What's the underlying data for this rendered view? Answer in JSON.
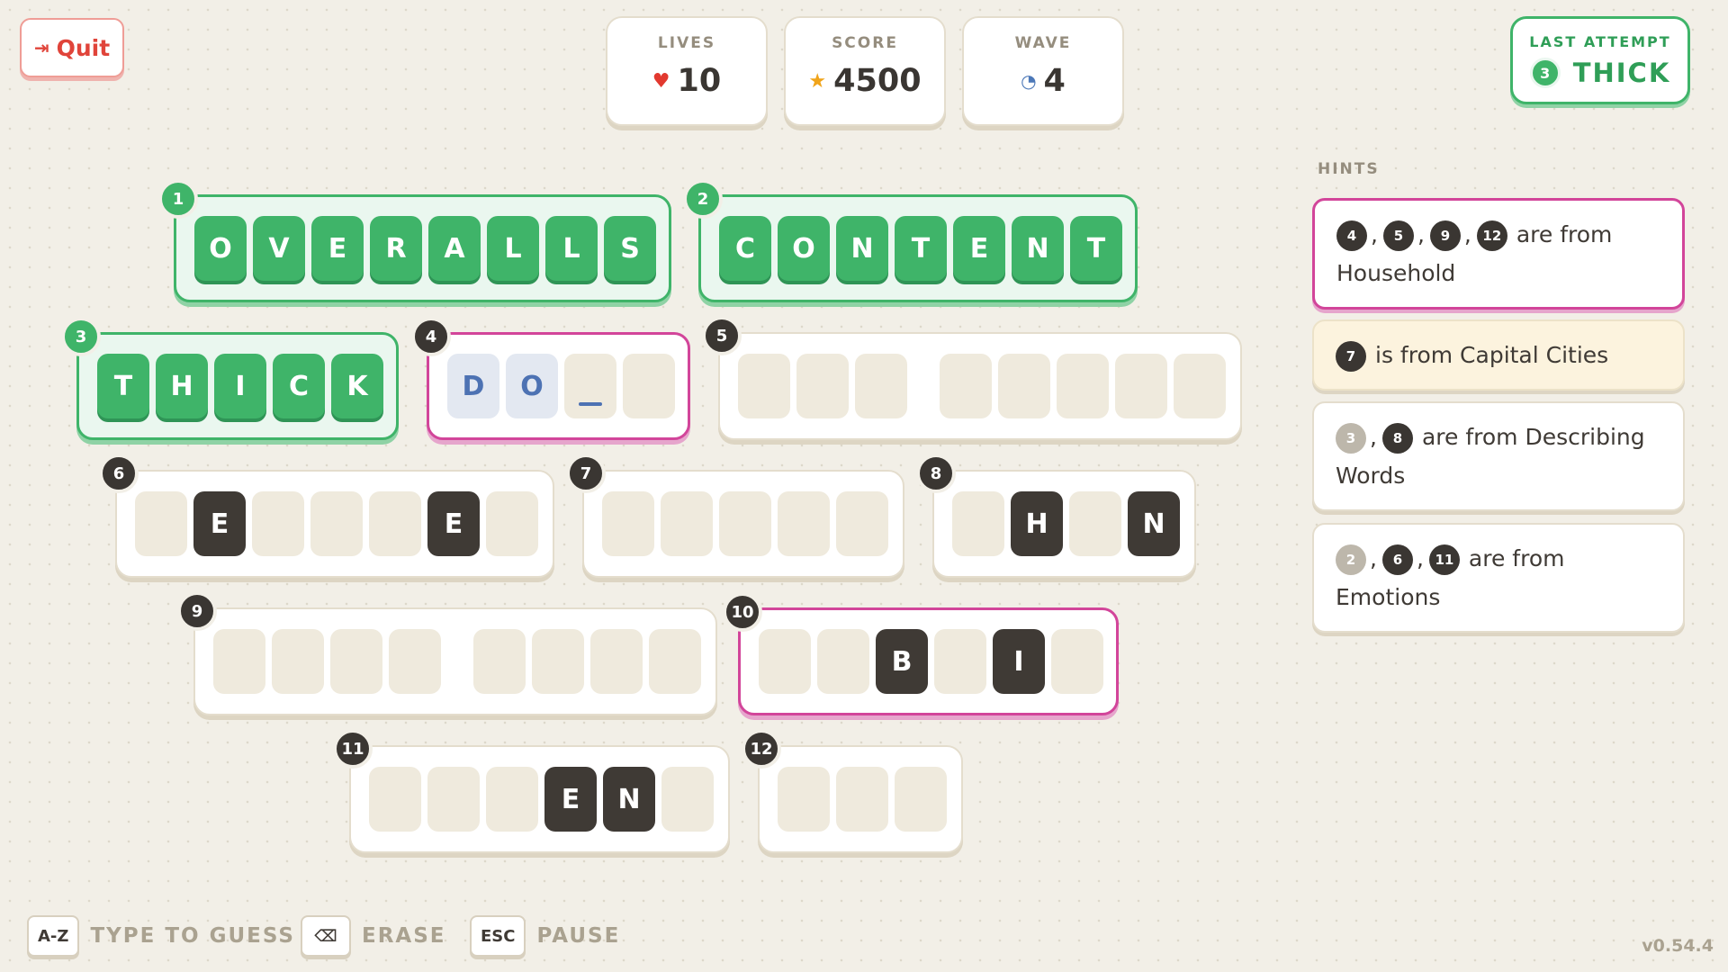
{
  "header": {
    "quit_label": "Quit",
    "lives_label": "LIVES",
    "lives_value": "10",
    "score_label": "SCORE",
    "score_value": "4500",
    "wave_label": "WAVE",
    "wave_value": "4"
  },
  "last_attempt": {
    "label": "LAST ATTEMPT",
    "number": "3",
    "word": "THICK"
  },
  "hints": {
    "title": "HINTS",
    "items": [
      {
        "numbers": [
          "4",
          "5",
          "9",
          "12"
        ],
        "done": [
          false,
          false,
          false,
          false
        ],
        "text": "are from Household",
        "highlight": "pink"
      },
      {
        "numbers": [
          "7"
        ],
        "done": [
          false
        ],
        "text": "is from Capital Cities",
        "highlight": "yellow"
      },
      {
        "numbers": [
          "3",
          "8"
        ],
        "done": [
          true,
          false
        ],
        "text": "are from Describing Words",
        "highlight": "none"
      },
      {
        "numbers": [
          "2",
          "6",
          "11"
        ],
        "done": [
          true,
          false,
          false
        ],
        "text": "are from Emotions",
        "highlight": "none"
      }
    ]
  },
  "words": [
    {
      "num": "1",
      "state": "solved",
      "tiles": [
        "O",
        "V",
        "E",
        "R",
        "A",
        "L",
        "L",
        "S"
      ]
    },
    {
      "num": "2",
      "state": "solved",
      "tiles": [
        "C",
        "O",
        "N",
        "T",
        "E",
        "N",
        "T"
      ]
    },
    {
      "num": "3",
      "state": "solved",
      "tiles": [
        "T",
        "H",
        "I",
        "C",
        "K"
      ]
    },
    {
      "num": "4",
      "state": "active",
      "tiles": [
        "D",
        "O",
        "",
        ""
      ],
      "typed": [
        true,
        true,
        false,
        false
      ],
      "cursor": 2
    },
    {
      "num": "5",
      "state": "empty",
      "tiles": [
        "",
        "",
        "",
        "|",
        "",
        "",
        "",
        "",
        ""
      ]
    },
    {
      "num": "6",
      "state": "empty",
      "tiles": [
        "",
        "E",
        "",
        "",
        "",
        "E",
        ""
      ]
    },
    {
      "num": "7",
      "state": "empty",
      "tiles": [
        "",
        "",
        "",
        "",
        ""
      ]
    },
    {
      "num": "8",
      "state": "empty",
      "tiles": [
        "",
        "H",
        "",
        "N"
      ]
    },
    {
      "num": "9",
      "state": "empty",
      "tiles": [
        "",
        "",
        "",
        "",
        "|",
        "",
        "",
        "",
        ""
      ]
    },
    {
      "num": "10",
      "state": "active",
      "tiles": [
        "",
        "",
        "B",
        "",
        "I",
        ""
      ]
    },
    {
      "num": "11",
      "state": "empty",
      "tiles": [
        "",
        "",
        "",
        "E",
        "N",
        ""
      ]
    },
    {
      "num": "12",
      "state": "empty",
      "tiles": [
        "",
        "",
        ""
      ]
    }
  ],
  "footer": {
    "key1": "A-Z",
    "label1": "TYPE TO GUESS",
    "key2": "⌫",
    "label2": "ERASE",
    "key3": "ESC",
    "label3": "PAUSE",
    "version": "v0.54.4"
  }
}
